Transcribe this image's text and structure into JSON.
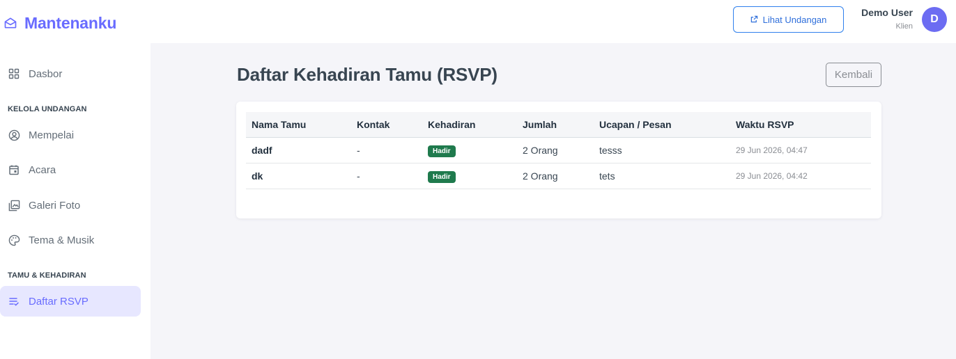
{
  "brand": {
    "name": "Mantenanku",
    "icon": "envelope-open-icon"
  },
  "sidebar": {
    "items": [
      {
        "label": "Dasbor",
        "icon": "grid-icon"
      },
      {
        "label": "Mempelai",
        "icon": "user-circle-icon"
      },
      {
        "label": "Acara",
        "icon": "calendar-icon"
      },
      {
        "label": "Galeri Foto",
        "icon": "photo-gallery-icon"
      },
      {
        "label": "Tema & Musik",
        "icon": "palette-icon"
      },
      {
        "label": "Daftar RSVP",
        "icon": "checklist-icon",
        "active": true
      }
    ],
    "headers": {
      "manage": "KELOLA UNDANGAN",
      "guests": "TAMU & KEHADIRAN"
    }
  },
  "topbar": {
    "preview_label": "Lihat Undangan",
    "preview_icon": "external-link-icon",
    "user_name": "Demo User",
    "user_role": "Klien",
    "avatar_initial": "D"
  },
  "page": {
    "title": "Daftar Kehadiran Tamu (RSVP)",
    "back_label": "Kembali"
  },
  "table": {
    "columns": [
      "Nama Tamu",
      "Kontak",
      "Kehadiran",
      "Jumlah",
      "Ucapan / Pesan",
      "Waktu RSVP"
    ],
    "rows": [
      {
        "name": "dadf",
        "contact": "-",
        "status": "Hadir",
        "count": "2 Orang",
        "message": "tesss",
        "time": "29 Jun 2026, 04:47"
      },
      {
        "name": "dk",
        "contact": "-",
        "status": "Hadir",
        "count": "2 Orang",
        "message": "tets",
        "time": "29 Jun 2026, 04:42"
      }
    ]
  },
  "colors": {
    "primary": "#696cff",
    "badge_success": "#1f7a4d",
    "link_blue": "#2f80ed"
  }
}
